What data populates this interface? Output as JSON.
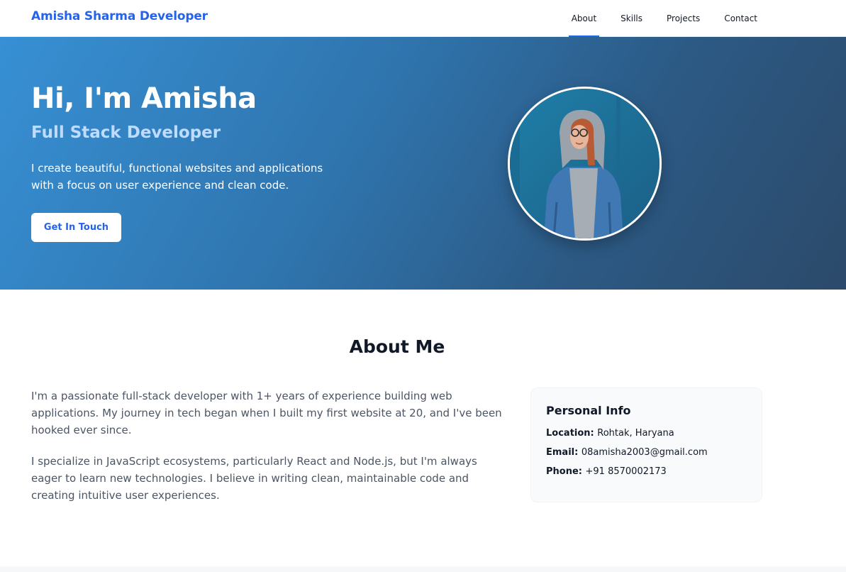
{
  "header": {
    "brand": "Amisha Sharma Developer",
    "nav": [
      {
        "label": "About",
        "active": true
      },
      {
        "label": "Skills",
        "active": false
      },
      {
        "label": "Projects",
        "active": false
      },
      {
        "label": "Contact",
        "active": false
      }
    ]
  },
  "hero": {
    "title": "Hi, I'm Amisha",
    "subtitle": "Full Stack Developer",
    "description": "I create beautiful, functional websites and applications with a focus on user experience and clean code.",
    "cta_label": "Get In Touch"
  },
  "about": {
    "title": "About Me",
    "paragraphs": [
      "I'm a passionate full-stack developer with 1+ years of experience building web applications. My journey in tech began when I built my first website at 20, and I've been hooked ever since.",
      "I specialize in JavaScript ecosystems, particularly React and Node.js, but I'm always eager to learn new technologies. I believe in writing clean, maintainable code and creating intuitive user experiences."
    ],
    "info": {
      "title": "Personal Info",
      "location_label": "Location:",
      "location": "Rohtak, Haryana",
      "email_label": "Email:",
      "email": "08amisha2003@gmail.com",
      "phone_label": "Phone:",
      "phone": "+91 8570002173"
    }
  },
  "colors": {
    "accent": "#2563eb",
    "hero_gradient_start": "#3790d4",
    "hero_gradient_end": "#2c4a6a",
    "subtitle": "#bfdbfe"
  }
}
